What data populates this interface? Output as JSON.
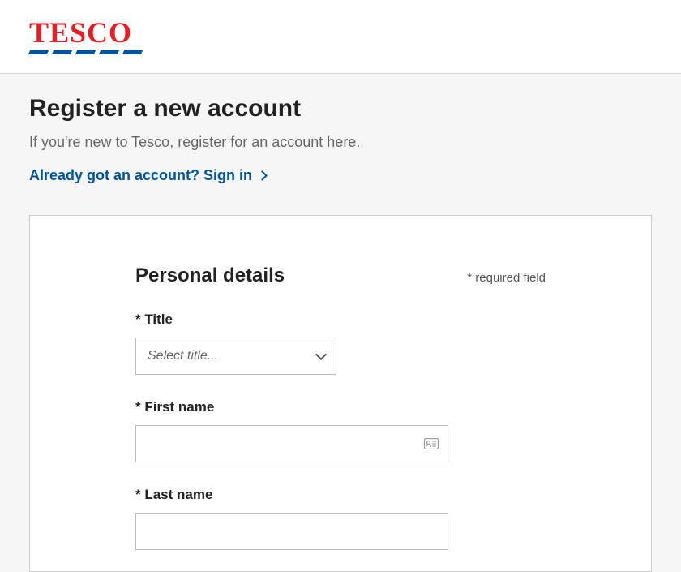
{
  "brand": {
    "name": "TESCO"
  },
  "page": {
    "title": "Register a new account",
    "subtitle": "If you're new to Tesco, register for an account here.",
    "signin_link": "Already got an account? Sign in"
  },
  "form": {
    "section_title": "Personal details",
    "required_note": "* required field",
    "fields": {
      "title": {
        "label": "* Title",
        "placeholder": "Select title..."
      },
      "first_name": {
        "label": "* First name",
        "value": ""
      },
      "last_name": {
        "label": "* Last name",
        "value": ""
      }
    }
  }
}
